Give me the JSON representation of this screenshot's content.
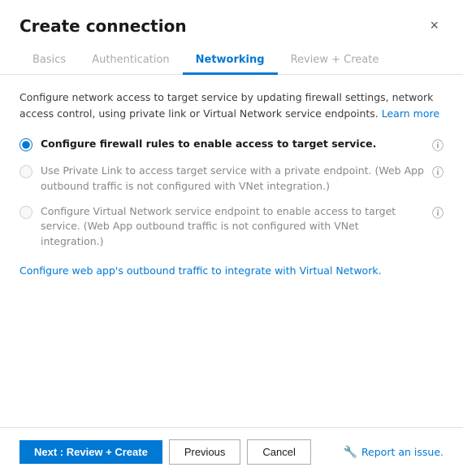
{
  "dialog": {
    "title": "Create connection",
    "close_label": "×"
  },
  "tabs": [
    {
      "id": "basics",
      "label": "Basics",
      "state": "inactive"
    },
    {
      "id": "authentication",
      "label": "Authentication",
      "state": "inactive"
    },
    {
      "id": "networking",
      "label": "Networking",
      "state": "active"
    },
    {
      "id": "review-create",
      "label": "Review + Create",
      "state": "inactive"
    }
  ],
  "description": {
    "main": "Configure network access to target service by updating firewall settings, network access control, using private link or Virtual Network service endpoints.",
    "learn_more": "Learn more"
  },
  "options": [
    {
      "id": "firewall",
      "label": "Configure firewall rules to enable access to target service.",
      "style": "bold",
      "selected": true,
      "disabled": false
    },
    {
      "id": "private-link",
      "label": "Use Private Link to access target service with a private endpoint. (Web App outbound traffic is not configured with VNet integration.)",
      "style": "muted",
      "selected": false,
      "disabled": true
    },
    {
      "id": "vnet-endpoint",
      "label": "Configure Virtual Network service endpoint to enable access to target service. (Web App outbound traffic is not configured with VNet integration.)",
      "style": "muted",
      "selected": false,
      "disabled": true
    }
  ],
  "vnet_link": {
    "text": "Configure web app's outbound traffic to integrate with Virtual Network."
  },
  "footer": {
    "next_label": "Next : Review + Create",
    "previous_label": "Previous",
    "cancel_label": "Cancel",
    "report_label": "Report an issue."
  }
}
